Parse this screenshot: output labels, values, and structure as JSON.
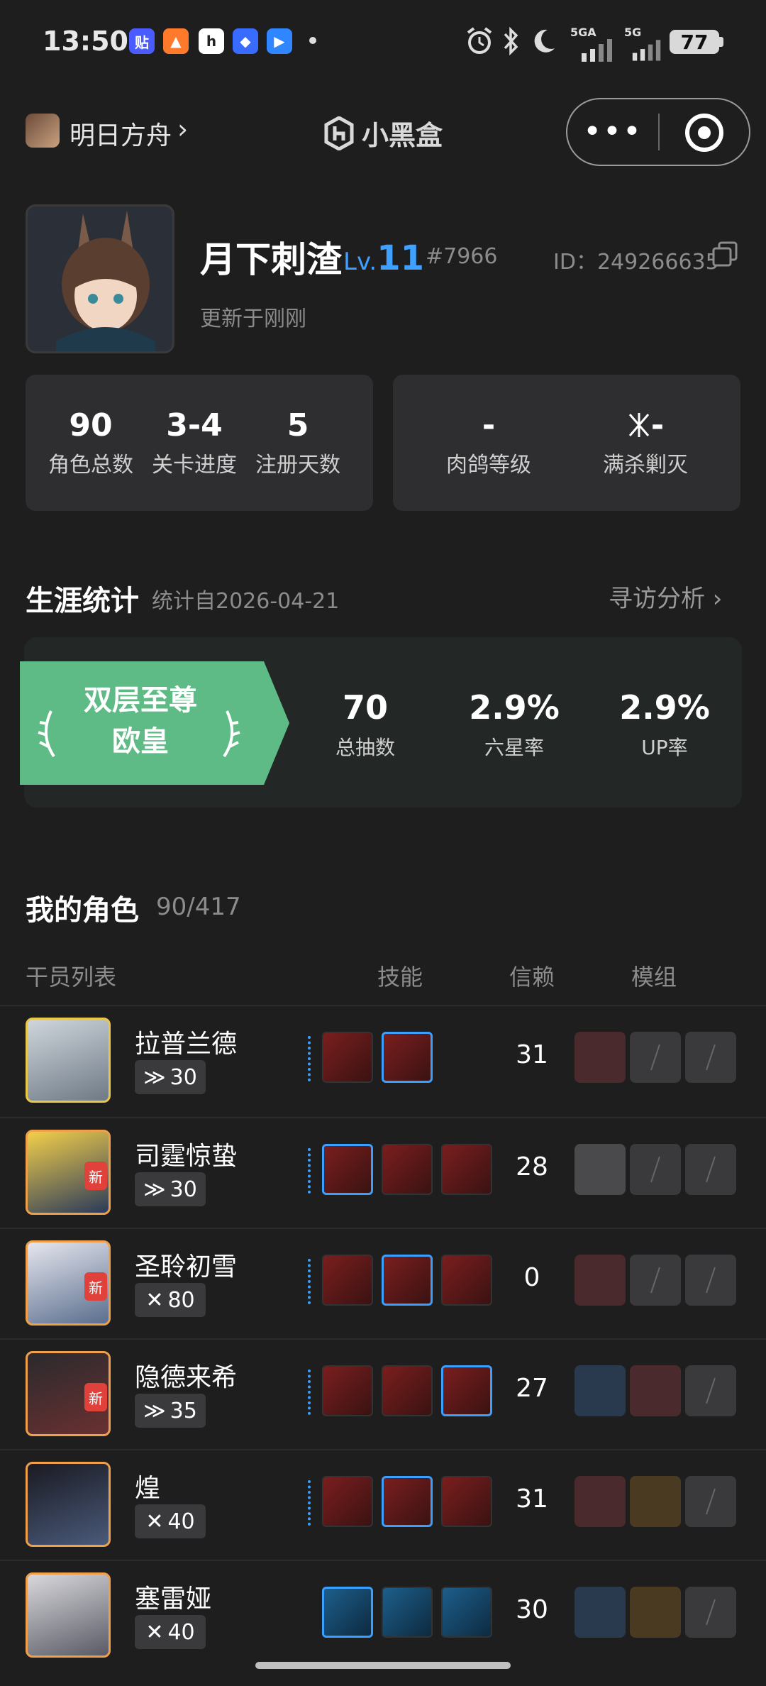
{
  "status_bar": {
    "time": "13:50",
    "battery": "77",
    "network_1": "5GA",
    "network_2": "5G"
  },
  "nav": {
    "game_name": "明日方舟",
    "brand": "小黑盒"
  },
  "profile": {
    "username": "月下刺渣",
    "level_prefix": "Lv.",
    "level": "11",
    "tag": "#7966",
    "uid": "ID：249266635",
    "updated": "更新于刚刚"
  },
  "stats_left": [
    {
      "value": "90",
      "label": "角色总数"
    },
    {
      "value": "3-4",
      "label": "关卡进度"
    },
    {
      "value": "5",
      "label": "注册天数"
    }
  ],
  "stats_right": [
    {
      "value": "-",
      "label": "肉鸽等级"
    },
    {
      "value": "-",
      "label": "满杀剿灭"
    }
  ],
  "career": {
    "title": "生涯统计",
    "since": "统计自2026-04-21",
    "link": "寻访分析",
    "badge_line1": "双层至尊",
    "badge_line2": "欧皇",
    "stats": [
      {
        "value": "70",
        "label": "总抽数"
      },
      {
        "value": "2.9%",
        "label": "六星率"
      },
      {
        "value": "2.9%",
        "label": "UP率"
      }
    ],
    "badge_color": "#5fbb86"
  },
  "roster": {
    "title": "我的角色",
    "count": "90/417",
    "headers": {
      "list": "干员列表",
      "skills": "技能",
      "trust": "信赖",
      "module": "模组"
    },
    "operators": [
      {
        "name": "拉普兰德",
        "level": "30",
        "trust": "31",
        "is_new": false,
        "frame": "#e8c84a"
      },
      {
        "name": "司霆惊蛰",
        "level": "30",
        "trust": "28",
        "is_new": true,
        "new_label": "新",
        "frame": "#f0a04b"
      },
      {
        "name": "圣聆初雪",
        "level": "80",
        "trust": "0",
        "is_new": true,
        "new_label": "新",
        "frame": "#f0a04b"
      },
      {
        "name": "隐德来希",
        "level": "35",
        "trust": "27",
        "is_new": true,
        "new_label": "新",
        "frame": "#f0a04b"
      },
      {
        "name": "煌",
        "level": "40",
        "trust": "31",
        "is_new": false,
        "frame": "#f0a04b"
      },
      {
        "name": "塞雷娅",
        "level": "40",
        "trust": "30",
        "is_new": false,
        "frame": "#f0a04b"
      }
    ]
  },
  "colors": {
    "accent": "#3fa0ff",
    "background": "#1e1e1f",
    "card": "#2e2e30"
  }
}
